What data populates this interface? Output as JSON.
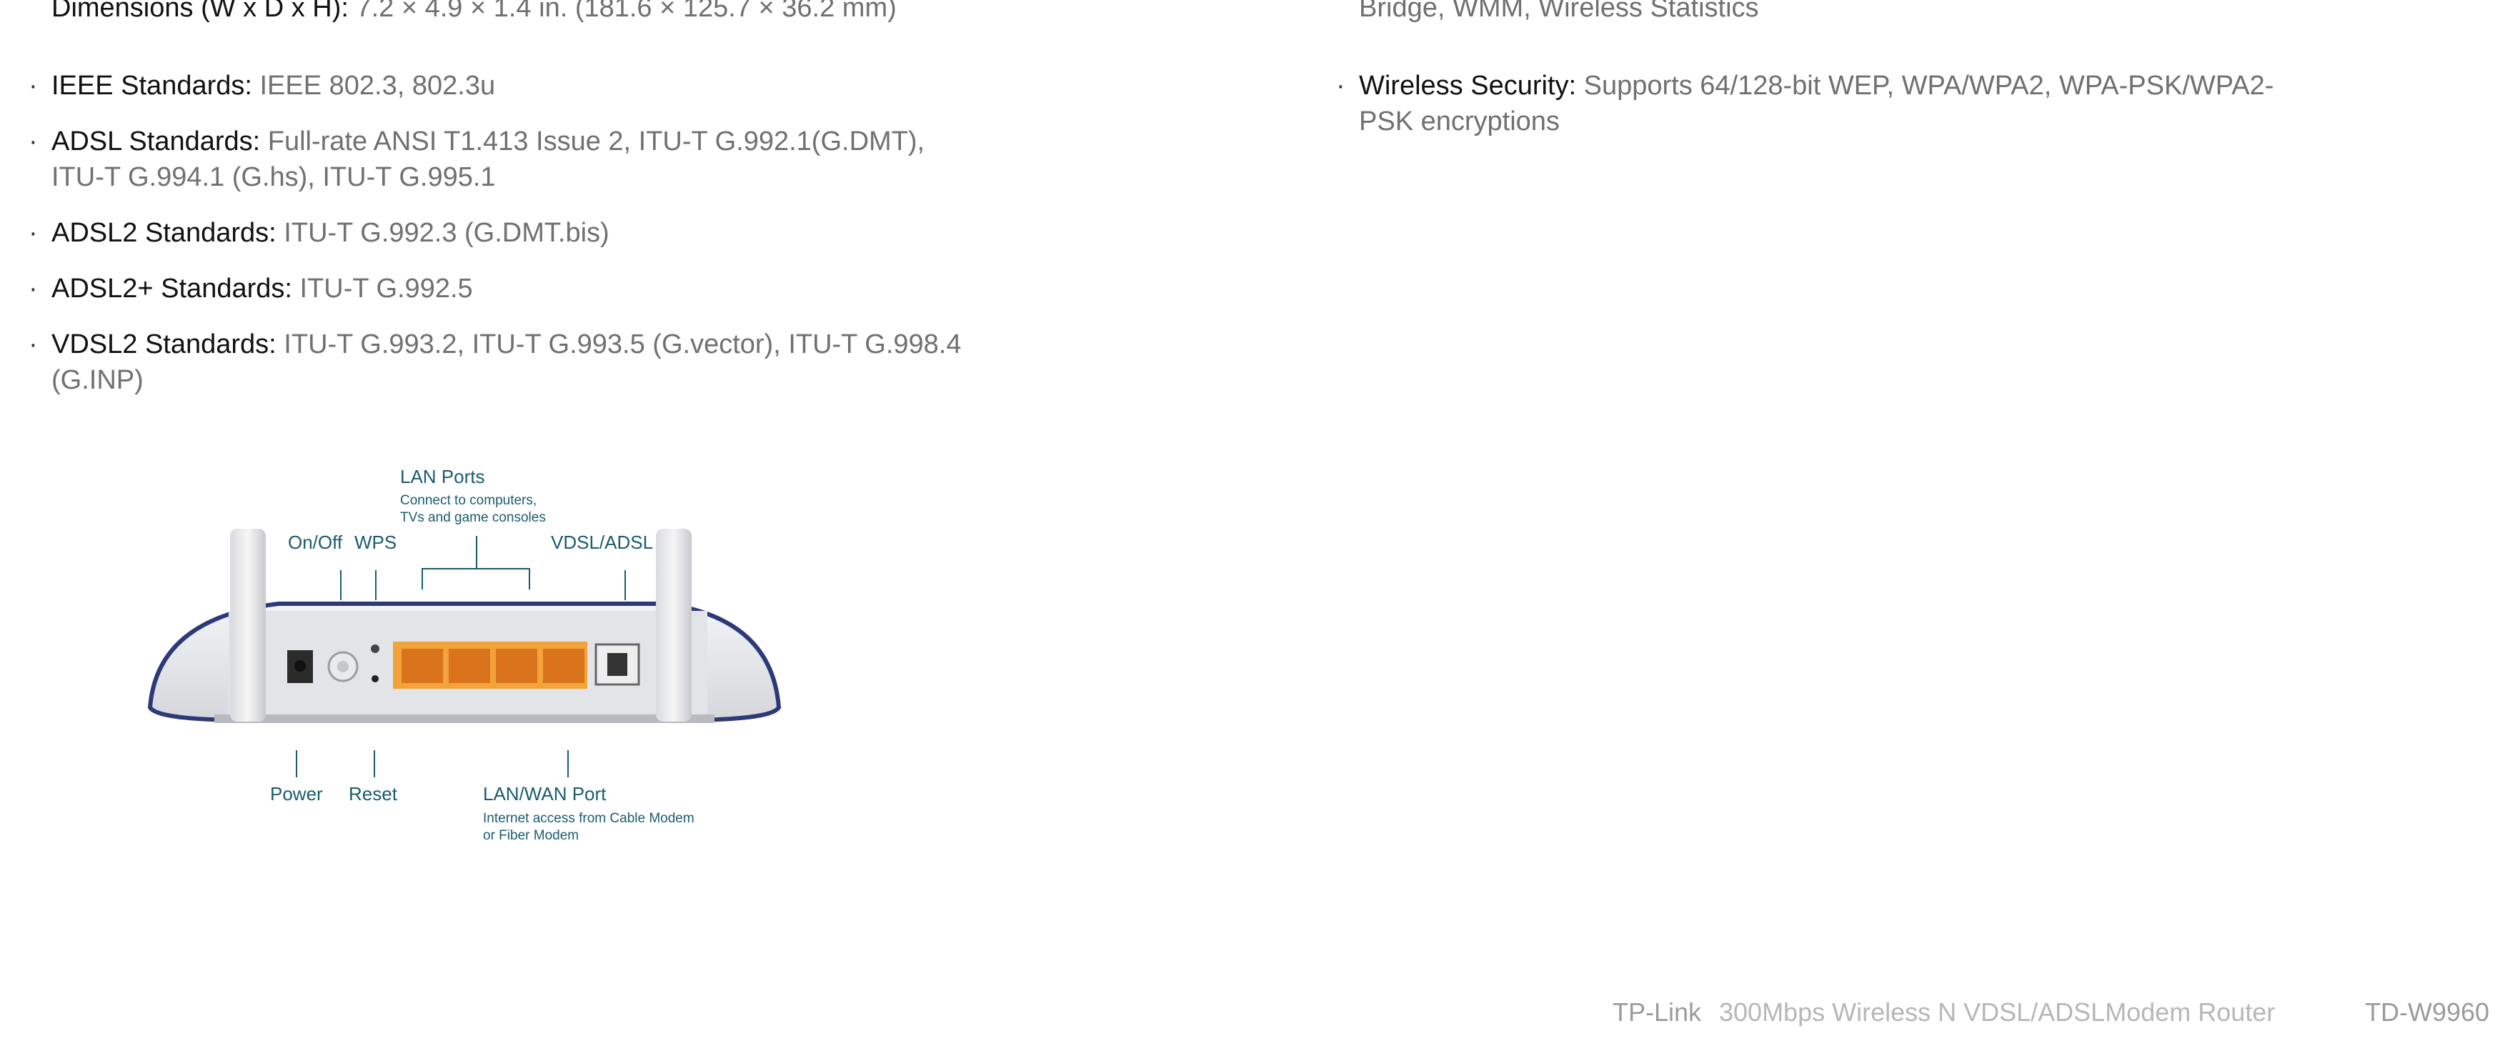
{
  "specs_left": [
    {
      "key": "IEEE Standards:",
      "value": " IEEE 802.3, 802.3u"
    },
    {
      "key": "ADSL Standards:",
      "value": " Full-rate ANSI T1.413 Issue 2, ITU-T G.992.1(G.DMT), ITU-T G.994.1 (G.hs), ITU-T G.995.1"
    },
    {
      "key": "ADSL2 Standards:",
      "value": " ITU-T G.992.3 (G.DMT.bis)"
    },
    {
      "key": "ADSL2+ Standards:",
      "value": " ITU-T G.992.5"
    },
    {
      "key": "VDSL2 Standards:",
      "value": " ITU-T G.993.2, ITU-T G.993.5 (G.vector), ITU-T G.998.4 (G.INP)"
    }
  ],
  "clipped_left": {
    "key": "Dimensions (W x D x H):",
    "value": " 7.2 × 4.9 × 1.4 in.  (181.6 × 125.7 × 36.2 mm)"
  },
  "clipped_right": {
    "value": "Bridge, WMM, Wireless Statistics"
  },
  "specs_right": [
    {
      "key": "Wireless Security:",
      "value": " Supports 64/128-bit WEP, WPA/WPA2, WPA-PSK/WPA2-PSK encryptions"
    }
  ],
  "diagram": {
    "lan_ports_title": "LAN Ports",
    "lan_ports_desc_1": "Connect to computers,",
    "lan_ports_desc_2": "TVs and game consoles",
    "on_off": "On/Off",
    "wps": "WPS",
    "vdsl_adsl": "VDSL/ADSL",
    "power": "Power",
    "reset": "Reset",
    "lan_wan_title": "LAN/WAN Port",
    "lan_wan_desc_1": "Internet access from Cable Modem",
    "lan_wan_desc_2": "or Fiber Modem",
    "colors": {
      "callout": "#1a5c6e",
      "shell": "#e8e9ed",
      "trim": "#2d3a7a",
      "ports": "#f2a33a"
    }
  },
  "footer": {
    "brand": "TP-Link",
    "product": "300Mbps Wireless N VDSL/ADSLModem Router",
    "model": "TD-W9960"
  }
}
